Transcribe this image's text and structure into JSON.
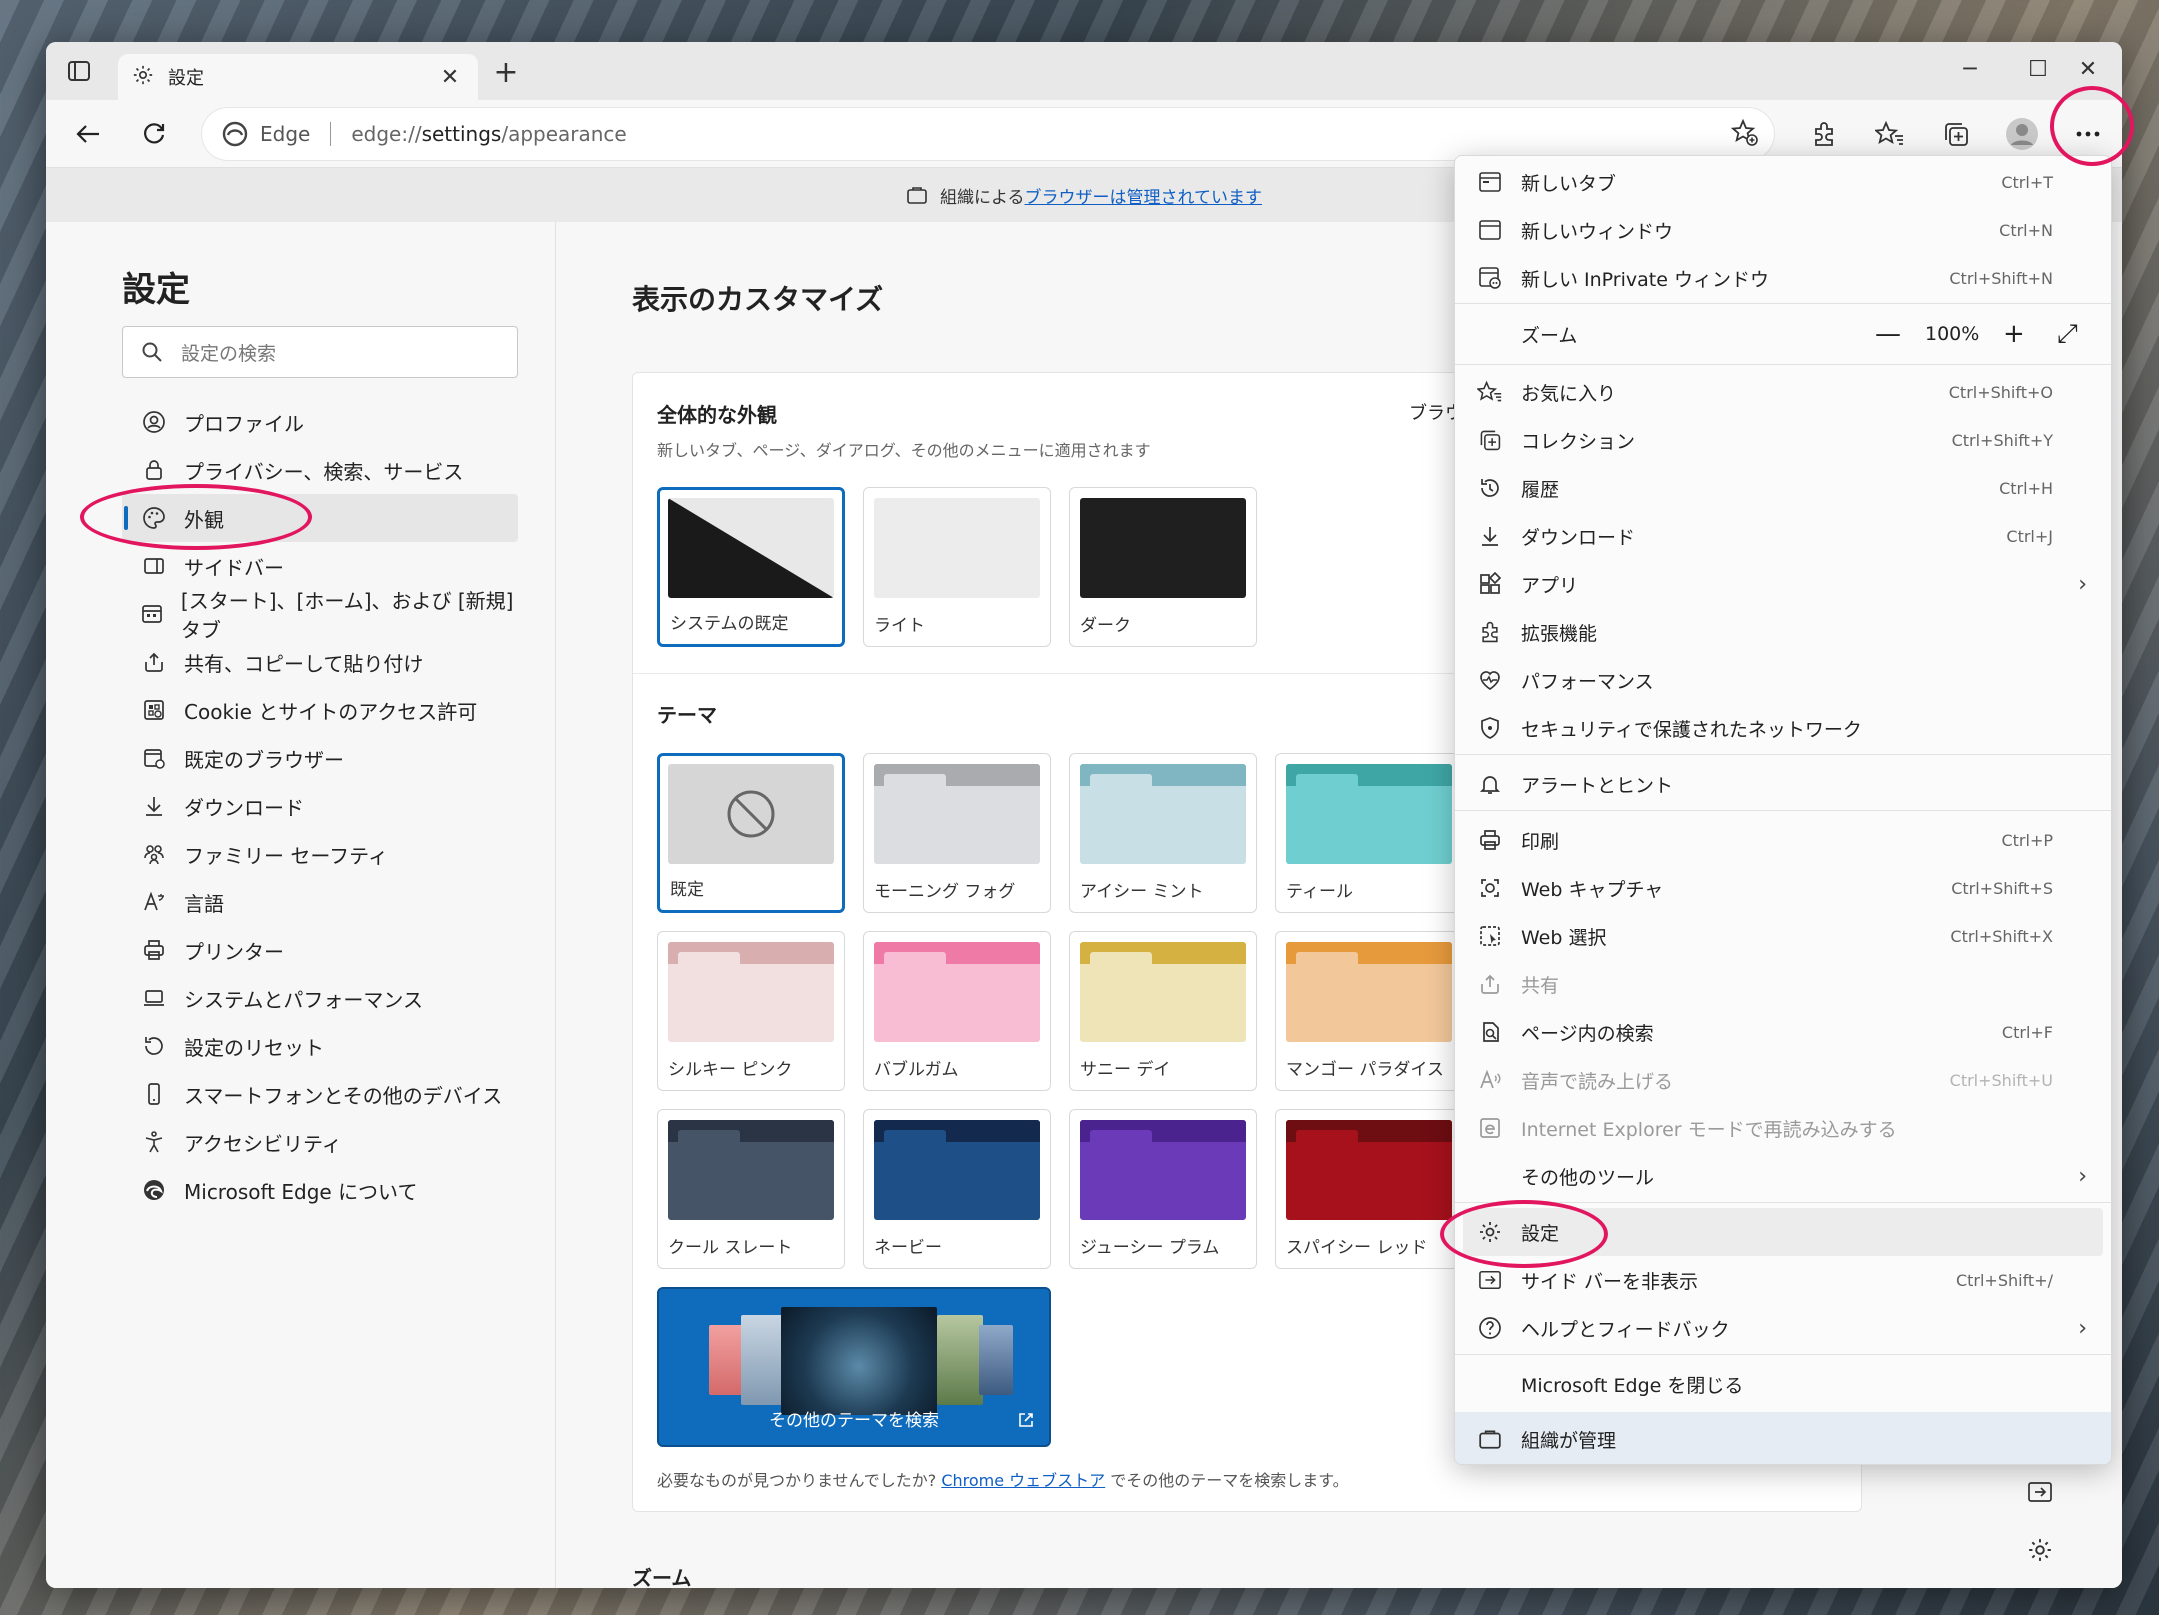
{
  "tab": {
    "title": "設定",
    "close": "✕",
    "new_tab": "+"
  },
  "window_controls": {
    "minimize": "─",
    "maximize": "☐",
    "close": "✕"
  },
  "address": {
    "edge_label": "Edge",
    "url_prefix": "edge://",
    "url_path": "settings",
    "url_suffix": "/appearance"
  },
  "managed_bar": {
    "text": "組織による",
    "link": "ブラウザーは管理されています"
  },
  "sidebar": {
    "title": "設定",
    "search_placeholder": "設定の検索",
    "items": [
      {
        "label": "プロファイル",
        "icon": "profile-icon"
      },
      {
        "label": "プライバシー、検索、サービス",
        "icon": "lock-icon"
      },
      {
        "label": "外観",
        "icon": "palette-icon"
      },
      {
        "label": "サイドバー",
        "icon": "sidebar-icon"
      },
      {
        "label": "[スタート]、[ホーム]、および [新規] タブ",
        "icon": "home-tab-icon"
      },
      {
        "label": "共有、コピーして貼り付け",
        "icon": "share-icon"
      },
      {
        "label": "Cookie とサイトのアクセス許可",
        "icon": "cookie-icon"
      },
      {
        "label": "既定のブラウザー",
        "icon": "browser-icon"
      },
      {
        "label": "ダウンロード",
        "icon": "download-icon"
      },
      {
        "label": "ファミリー セーフティ",
        "icon": "family-icon"
      },
      {
        "label": "言語",
        "icon": "language-icon"
      },
      {
        "label": "プリンター",
        "icon": "printer-icon"
      },
      {
        "label": "システムとパフォーマンス",
        "icon": "laptop-icon"
      },
      {
        "label": "設定のリセット",
        "icon": "reset-icon"
      },
      {
        "label": "スマートフォンとその他のデバイス",
        "icon": "phone-icon"
      },
      {
        "label": "アクセシビリティ",
        "icon": "accessibility-icon"
      },
      {
        "label": "Microsoft Edge について",
        "icon": "edge-logo-icon"
      }
    ]
  },
  "main": {
    "title": "表示のカスタマイズ",
    "overall": {
      "title": "全体的な外観",
      "desc": "新しいタブ、ページ、ダイアログ、その他のメニューに適用されます",
      "browser_cut": "ブラウザ",
      "options": [
        {
          "label": "システムの既定",
          "selected": true
        },
        {
          "label": "ライト",
          "selected": false
        },
        {
          "label": "ダーク",
          "selected": false
        }
      ]
    },
    "themes": {
      "title": "テーマ",
      "items": [
        {
          "label": "既定",
          "top": "#d6d6d6",
          "body": "#d6d6d6",
          "selected": true
        },
        {
          "label": "モーニング フォグ",
          "top": "#a9abae",
          "body": "#dcdde0"
        },
        {
          "label": "アイシー ミント",
          "top": "#7fb6c1",
          "body": "#c7dfe5"
        },
        {
          "label": "ティール",
          "top": "#3fa6a6",
          "body": "#6fcfd0"
        },
        {
          "label": "シルキー ピンク",
          "top": "#d8afae",
          "body": "#f2e0e0"
        },
        {
          "label": "バブルガム",
          "top": "#f07aa6",
          "body": "#f8bcd3"
        },
        {
          "label": "サニー デイ",
          "top": "#d4b141",
          "body": "#efe3b8"
        },
        {
          "label": "マンゴー パラダイス",
          "top": "#e79a3c",
          "body": "#f2c89a"
        },
        {
          "label": "クール スレート",
          "top": "#2b3444",
          "body": "#465468"
        },
        {
          "label": "ネービー",
          "top": "#13294d",
          "body": "#1f4f87"
        },
        {
          "label": "ジューシー プラム",
          "top": "#4a238f",
          "body": "#6a3ab8"
        },
        {
          "label": "スパイシー レッド",
          "top": "#6e0d12",
          "body": "#a6111c"
        }
      ],
      "more_label": "その他のテーマを検索",
      "note_before": "必要なものが見つかりませんでしたか? ",
      "note_link": "Chrome ウェブストア",
      "note_after": " でその他のテーマを検索します。"
    },
    "zoom_title": "ズーム"
  },
  "menu": {
    "new_tab": {
      "label": "新しいタブ",
      "sc": "Ctrl+T"
    },
    "new_window": {
      "label": "新しいウィンドウ",
      "sc": "Ctrl+N"
    },
    "new_inprivate": {
      "label": "新しい InPrivate ウィンドウ",
      "sc": "Ctrl+Shift+N"
    },
    "zoom": {
      "label": "ズーム",
      "minus": "—",
      "value": "100%",
      "plus": "+",
      "full": "⤢"
    },
    "favorites": {
      "label": "お気に入り",
      "sc": "Ctrl+Shift+O"
    },
    "collections": {
      "label": "コレクション",
      "sc": "Ctrl+Shift+Y"
    },
    "history": {
      "label": "履歴",
      "sc": "Ctrl+H"
    },
    "downloads": {
      "label": "ダウンロード",
      "sc": "Ctrl+J"
    },
    "apps": {
      "label": "アプリ",
      "chev": "›"
    },
    "extensions": {
      "label": "拡張機能"
    },
    "performance": {
      "label": "パフォーマンス"
    },
    "secure_network": {
      "label": "セキュリティで保護されたネットワーク"
    },
    "alerts": {
      "label": "アラートとヒント"
    },
    "print": {
      "label": "印刷",
      "sc": "Ctrl+P"
    },
    "web_capture": {
      "label": "Web キャプチャ",
      "sc": "Ctrl+Shift+S"
    },
    "web_select": {
      "label": "Web 選択",
      "sc": "Ctrl+Shift+X"
    },
    "share": {
      "label": "共有"
    },
    "find": {
      "label": "ページ内の検索",
      "sc": "Ctrl+F"
    },
    "read_aloud": {
      "label": "音声で読み上げる",
      "sc": "Ctrl+Shift+U"
    },
    "ie_mode": {
      "label": "Internet Explorer モードで再読み込みする"
    },
    "more_tools": {
      "label": "その他のツール",
      "chev": "›"
    },
    "settings": {
      "label": "設定"
    },
    "hide_sidebar": {
      "label": "サイド バーを非表示",
      "sc": "Ctrl+Shift+/"
    },
    "help": {
      "label": "ヘルプとフィードバック",
      "chev": "›"
    },
    "close_edge": {
      "label": "Microsoft Edge を閉じる"
    },
    "managed": {
      "label": "組織が管理"
    }
  },
  "colors": {
    "accent": "#0f6cbd",
    "annotation": "#e2165f"
  }
}
